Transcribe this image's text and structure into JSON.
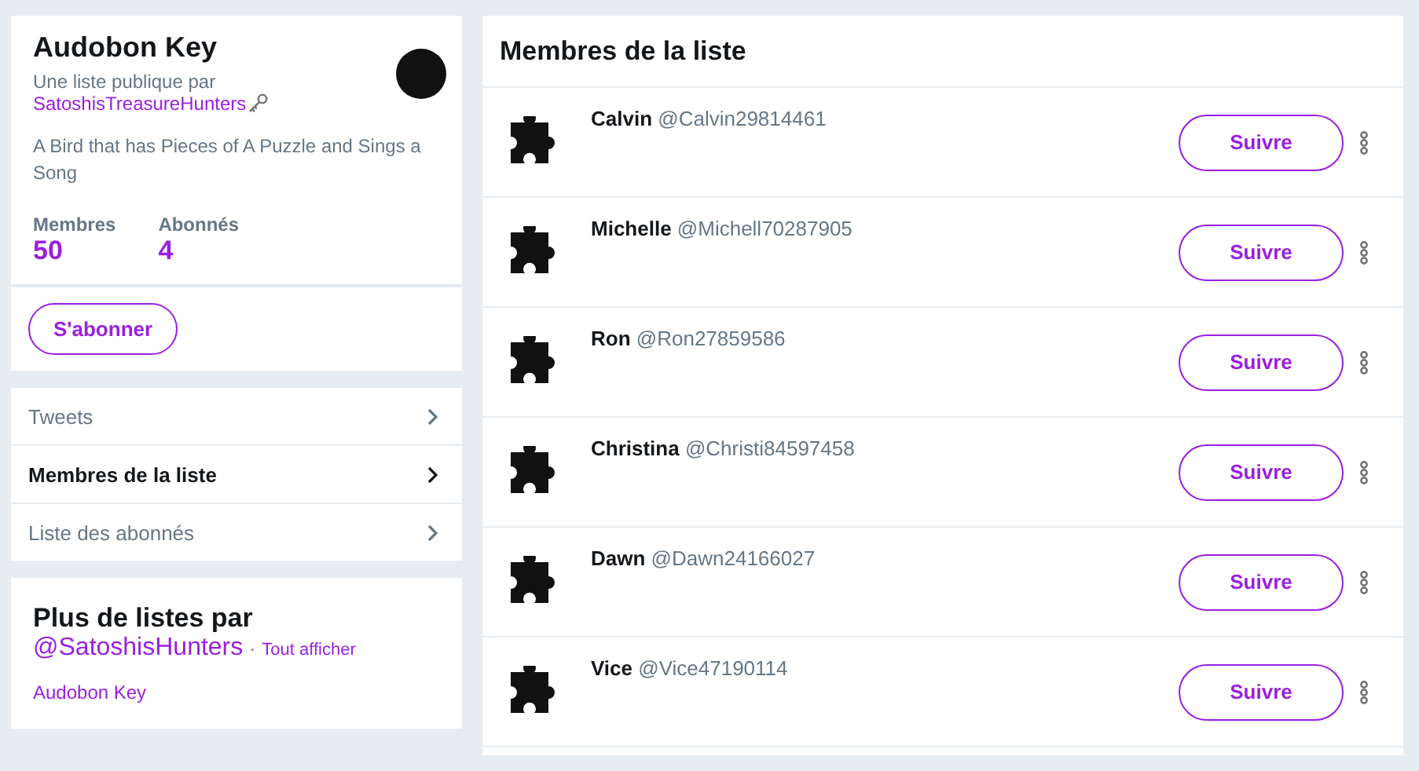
{
  "list_card": {
    "title": "Audobon Key",
    "byline": "Une liste publique par",
    "owner": "SatoshisTreasureHunters",
    "description": "A Bird that has Pieces of A Puzzle and Sings a Song",
    "stats": [
      {
        "label": "Membres",
        "value": "50"
      },
      {
        "label": "Abonnés",
        "value": "4"
      }
    ],
    "subscribe_button": "S'abonner"
  },
  "nav": [
    {
      "label": "Tweets",
      "selected": false
    },
    {
      "label": "Membres de la liste",
      "selected": true
    },
    {
      "label": "Liste des abonnés",
      "selected": false
    }
  ],
  "more_lists": {
    "title": "Plus de listes par",
    "handle": "@SatoshisHunters",
    "separator": "·",
    "see_all": "Tout afficher",
    "lists": [
      "Audobon Key"
    ]
  },
  "members_panel": {
    "title": "Membres de la liste",
    "members": [
      {
        "name": "Calvin",
        "handle": "@Calvin29814461",
        "button": "Suivre"
      },
      {
        "name": "Michelle",
        "handle": "@Michell70287905",
        "button": "Suivre"
      },
      {
        "name": "Ron",
        "handle": "@Ron27859586",
        "button": "Suivre"
      },
      {
        "name": "Christina",
        "handle": "@Christi84597458",
        "button": "Suivre"
      },
      {
        "name": "Dawn",
        "handle": "@Dawn24166027",
        "button": "Suivre"
      },
      {
        "name": "Vice",
        "handle": "@Vice47190114",
        "button": "Suivre"
      }
    ]
  }
}
